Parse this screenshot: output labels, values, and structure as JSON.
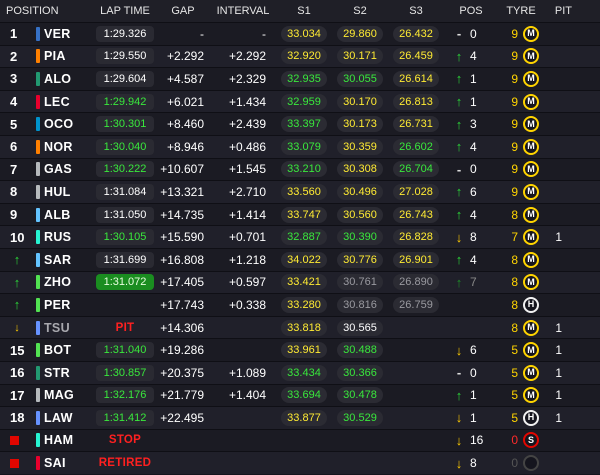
{
  "headers": {
    "position": "POSITION",
    "lap_time": "LAP TIME",
    "gap": "GAP",
    "interval": "INTERVAL",
    "s1": "S1",
    "s2": "S2",
    "s3": "S3",
    "pos": "POS",
    "tyre": "TYRE",
    "pit": "PIT"
  },
  "colors": {
    "sector_green": "#39e83c",
    "sector_yellow": "#ffeb33",
    "best_lap_bg": "#1a8d20",
    "status_red": "#ff2020",
    "tyre_medium": "#ffd400",
    "tyre_hard": "#f2f2f2",
    "tyre_soft": "#e10600"
  },
  "rows": [
    {
      "pos": "1",
      "pos_icon": "",
      "team": "#3671c6",
      "driver": "VER",
      "lap": "1:29.326",
      "lap_style": "white",
      "gap": "-",
      "interval": "-",
      "s1": "33.034",
      "s1c": "yellow",
      "s2": "29.860",
      "s2c": "yellow",
      "s3": "26.432",
      "s3c": "yellow",
      "change_icon": "arrow-flat-icon",
      "change_sym": "-",
      "change_style": "flat",
      "change": "0",
      "tyre_laps": "9",
      "tyre_laps_style": "yellow",
      "tyre": "M",
      "tyre_type": "medium",
      "pit": ""
    },
    {
      "pos": "2",
      "pos_icon": "",
      "team": "#ff8000",
      "driver": "PIA",
      "lap": "1:29.550",
      "lap_style": "white",
      "gap": "+2.292",
      "interval": "+2.292",
      "s1": "32.920",
      "s1c": "yellow",
      "s2": "30.171",
      "s2c": "yellow",
      "s3": "26.459",
      "s3c": "yellow",
      "change_icon": "arrow-up-icon",
      "change_sym": "↑",
      "change_style": "up",
      "change": "4",
      "tyre_laps": "9",
      "tyre_laps_style": "yellow",
      "tyre": "M",
      "tyre_type": "medium",
      "pit": ""
    },
    {
      "pos": "3",
      "pos_icon": "",
      "team": "#229971",
      "driver": "ALO",
      "lap": "1:29.604",
      "lap_style": "white",
      "gap": "+4.587",
      "interval": "+2.329",
      "s1": "32.935",
      "s1c": "green",
      "s2": "30.055",
      "s2c": "green",
      "s3": "26.614",
      "s3c": "yellow",
      "change_icon": "arrow-up-icon",
      "change_sym": "↑",
      "change_style": "up",
      "change": "1",
      "tyre_laps": "9",
      "tyre_laps_style": "yellow",
      "tyre": "M",
      "tyre_type": "medium",
      "pit": ""
    },
    {
      "pos": "4",
      "pos_icon": "",
      "team": "#e8002d",
      "driver": "LEC",
      "lap": "1:29.942",
      "lap_style": "green",
      "gap": "+6.021",
      "interval": "+1.434",
      "s1": "32.959",
      "s1c": "green",
      "s2": "30.170",
      "s2c": "yellow",
      "s3": "26.813",
      "s3c": "yellow",
      "change_icon": "arrow-up-icon",
      "change_sym": "↑",
      "change_style": "up",
      "change": "1",
      "tyre_laps": "9",
      "tyre_laps_style": "yellow",
      "tyre": "M",
      "tyre_type": "medium",
      "pit": ""
    },
    {
      "pos": "5",
      "pos_icon": "",
      "team": "#0093cc",
      "driver": "OCO",
      "lap": "1:30.301",
      "lap_style": "green",
      "gap": "+8.460",
      "interval": "+2.439",
      "s1": "33.397",
      "s1c": "green",
      "s2": "30.173",
      "s2c": "yellow",
      "s3": "26.731",
      "s3c": "yellow",
      "change_icon": "arrow-up-icon",
      "change_sym": "↑",
      "change_style": "up",
      "change": "3",
      "tyre_laps": "9",
      "tyre_laps_style": "yellow",
      "tyre": "M",
      "tyre_type": "medium",
      "pit": ""
    },
    {
      "pos": "6",
      "pos_icon": "",
      "team": "#ff8000",
      "driver": "NOR",
      "lap": "1:30.040",
      "lap_style": "green",
      "gap": "+8.946",
      "interval": "+0.486",
      "s1": "33.079",
      "s1c": "green",
      "s2": "30.359",
      "s2c": "yellow",
      "s3": "26.602",
      "s3c": "green",
      "change_icon": "arrow-up-icon",
      "change_sym": "↑",
      "change_style": "up",
      "change": "4",
      "tyre_laps": "9",
      "tyre_laps_style": "yellow",
      "tyre": "M",
      "tyre_type": "medium",
      "pit": ""
    },
    {
      "pos": "7",
      "pos_icon": "",
      "team": "#b6babd",
      "driver": "GAS",
      "lap": "1:30.222",
      "lap_style": "green",
      "gap": "+10.607",
      "interval": "+1.545",
      "s1": "33.210",
      "s1c": "green",
      "s2": "30.308",
      "s2c": "yellow",
      "s3": "26.704",
      "s3c": "green",
      "change_icon": "arrow-flat-icon",
      "change_sym": "-",
      "change_style": "flat",
      "change": "0",
      "tyre_laps": "9",
      "tyre_laps_style": "yellow",
      "tyre": "M",
      "tyre_type": "medium",
      "pit": ""
    },
    {
      "pos": "8",
      "pos_icon": "",
      "team": "#b6babd",
      "driver": "HUL",
      "lap": "1:31.084",
      "lap_style": "white",
      "gap": "+13.321",
      "interval": "+2.710",
      "s1": "33.560",
      "s1c": "yellow",
      "s2": "30.496",
      "s2c": "yellow",
      "s3": "27.028",
      "s3c": "yellow",
      "change_icon": "arrow-up-icon",
      "change_sym": "↑",
      "change_style": "up",
      "change": "6",
      "tyre_laps": "9",
      "tyre_laps_style": "yellow",
      "tyre": "M",
      "tyre_type": "medium",
      "pit": ""
    },
    {
      "pos": "9",
      "pos_icon": "",
      "team": "#64c4ff",
      "driver": "ALB",
      "lap": "1:31.050",
      "lap_style": "white",
      "gap": "+14.735",
      "interval": "+1.414",
      "s1": "33.747",
      "s1c": "yellow",
      "s2": "30.560",
      "s2c": "yellow",
      "s3": "26.743",
      "s3c": "yellow",
      "change_icon": "arrow-up-icon",
      "change_sym": "↑",
      "change_style": "up",
      "change": "4",
      "tyre_laps": "8",
      "tyre_laps_style": "yellow",
      "tyre": "M",
      "tyre_type": "medium",
      "pit": ""
    },
    {
      "pos": "10",
      "pos_icon": "",
      "team": "#27f4d2",
      "driver": "RUS",
      "lap": "1:30.105",
      "lap_style": "green",
      "gap": "+15.590",
      "interval": "+0.701",
      "s1": "32.887",
      "s1c": "green",
      "s2": "30.390",
      "s2c": "green",
      "s3": "26.828",
      "s3c": "yellow",
      "change_icon": "arrow-down-icon",
      "change_sym": "↓",
      "change_style": "down",
      "change": "8",
      "tyre_laps": "7",
      "tyre_laps_style": "yellow",
      "tyre": "M",
      "tyre_type": "medium",
      "pit": "1"
    },
    {
      "pos": "",
      "pos_icon": "up",
      "team": "#64c4ff",
      "driver": "SAR",
      "lap": "1:31.699",
      "lap_style": "white",
      "gap": "+16.808",
      "interval": "+1.218",
      "s1": "34.022",
      "s1c": "yellow",
      "s2": "30.776",
      "s2c": "yellow",
      "s3": "26.901",
      "s3c": "yellow",
      "change_icon": "arrow-up-icon",
      "change_sym": "↑",
      "change_style": "up",
      "change": "4",
      "tyre_laps": "8",
      "tyre_laps_style": "yellow",
      "tyre": "M",
      "tyre_type": "medium",
      "pit": ""
    },
    {
      "pos": "",
      "pos_icon": "up",
      "team": "#52e252",
      "driver": "ZHO",
      "lap": "1:31.072",
      "lap_style": "best",
      "gap": "+17.405",
      "interval": "+0.597",
      "s1": "33.421",
      "s1c": "yellow",
      "s2": "30.761",
      "s2c": "grey",
      "s3": "26.890",
      "s3c": "grey",
      "change_icon": "arrow-up-icon",
      "change_sym": "↑",
      "change_style": "updim",
      "change": "7",
      "tyre_laps": "8",
      "tyre_laps_style": "yellow",
      "tyre": "M",
      "tyre_type": "medium",
      "pit": ""
    },
    {
      "pos": "",
      "pos_icon": "up",
      "team": "#52e252",
      "driver": "PER",
      "lap": "",
      "lap_style": "none",
      "gap": "+17.743",
      "interval": "+0.338",
      "s1": "33.280",
      "s1c": "yellow",
      "s2": "30.816",
      "s2c": "grey",
      "s3": "26.759",
      "s3c": "grey",
      "change_icon": "",
      "change_sym": "",
      "change_style": "none",
      "change": "",
      "tyre_laps": "8",
      "tyre_laps_style": "yellow",
      "tyre": "H",
      "tyre_type": "hard",
      "pit": ""
    },
    {
      "pos": "",
      "pos_icon": "down",
      "team": "#6692ff",
      "driver": "TSU",
      "lap": "PIT",
      "lap_style": "status",
      "gap": "+14.306",
      "interval": "",
      "s1": "33.818",
      "s1c": "yellow",
      "s2": "30.565",
      "s2c": "white",
      "s3": "",
      "s3c": "none",
      "change_icon": "",
      "change_sym": "",
      "change_style": "none",
      "change": "",
      "tyre_laps": "8",
      "tyre_laps_style": "yellow",
      "tyre": "M",
      "tyre_type": "medium",
      "pit": "1"
    },
    {
      "pos": "15",
      "pos_icon": "",
      "team": "#52e252",
      "driver": "BOT",
      "lap": "1:31.040",
      "lap_style": "green",
      "gap": "+19.286",
      "interval": "",
      "s1": "33.961",
      "s1c": "yellow",
      "s2": "30.488",
      "s2c": "green",
      "s3": "",
      "s3c": "none",
      "change_icon": "arrow-down-icon",
      "change_sym": "↓",
      "change_style": "down",
      "change": "6",
      "tyre_laps": "5",
      "tyre_laps_style": "yellow",
      "tyre": "M",
      "tyre_type": "medium",
      "pit": "1"
    },
    {
      "pos": "16",
      "pos_icon": "",
      "team": "#229971",
      "driver": "STR",
      "lap": "1:30.857",
      "lap_style": "green",
      "gap": "+20.375",
      "interval": "+1.089",
      "s1": "33.434",
      "s1c": "green",
      "s2": "30.366",
      "s2c": "green",
      "s3": "",
      "s3c": "none",
      "change_icon": "arrow-flat-icon",
      "change_sym": "-",
      "change_style": "flat",
      "change": "0",
      "tyre_laps": "5",
      "tyre_laps_style": "yellow",
      "tyre": "M",
      "tyre_type": "medium",
      "pit": "1"
    },
    {
      "pos": "17",
      "pos_icon": "",
      "team": "#b6babd",
      "driver": "MAG",
      "lap": "1:32.176",
      "lap_style": "green",
      "gap": "+21.779",
      "interval": "+1.404",
      "s1": "33.694",
      "s1c": "green",
      "s2": "30.478",
      "s2c": "green",
      "s3": "",
      "s3c": "none",
      "change_icon": "arrow-up-icon",
      "change_sym": "↑",
      "change_style": "up",
      "change": "1",
      "tyre_laps": "5",
      "tyre_laps_style": "yellow",
      "tyre": "M",
      "tyre_type": "medium",
      "pit": "1"
    },
    {
      "pos": "18",
      "pos_icon": "",
      "team": "#6692ff",
      "driver": "LAW",
      "lap": "1:31.412",
      "lap_style": "green",
      "gap": "+22.495",
      "interval": "",
      "s1": "33.877",
      "s1c": "yellow",
      "s2": "30.529",
      "s2c": "green",
      "s3": "",
      "s3c": "none",
      "change_icon": "arrow-down-icon",
      "change_sym": "↓",
      "change_style": "down",
      "change": "1",
      "tyre_laps": "5",
      "tyre_laps_style": "yellow",
      "tyre": "H",
      "tyre_type": "hard",
      "pit": "1"
    },
    {
      "pos": "",
      "pos_icon": "flag",
      "team": "#27f4d2",
      "driver": "HAM",
      "lap": "STOP",
      "lap_style": "status",
      "gap": "",
      "interval": "",
      "s1": "",
      "s1c": "none",
      "s2": "",
      "s2c": "none",
      "s3": "",
      "s3c": "none",
      "change_icon": "arrow-down-icon",
      "change_sym": "↓",
      "change_style": "down",
      "change": "16",
      "tyre_laps": "0",
      "tyre_laps_style": "red",
      "tyre": "S",
      "tyre_type": "soft",
      "pit": ""
    },
    {
      "pos": "",
      "pos_icon": "flag",
      "team": "#e8002d",
      "driver": "SAI",
      "lap": "RETIRED",
      "lap_style": "status",
      "gap": "",
      "interval": "",
      "s1": "",
      "s1c": "none",
      "s2": "",
      "s2c": "none",
      "s3": "",
      "s3c": "none",
      "change_icon": "arrow-down-icon",
      "change_sym": "↓",
      "change_style": "down",
      "change": "8",
      "tyre_laps": "0",
      "tyre_laps_style": "grey",
      "tyre": "",
      "tyre_type": "unknown",
      "pit": ""
    }
  ]
}
